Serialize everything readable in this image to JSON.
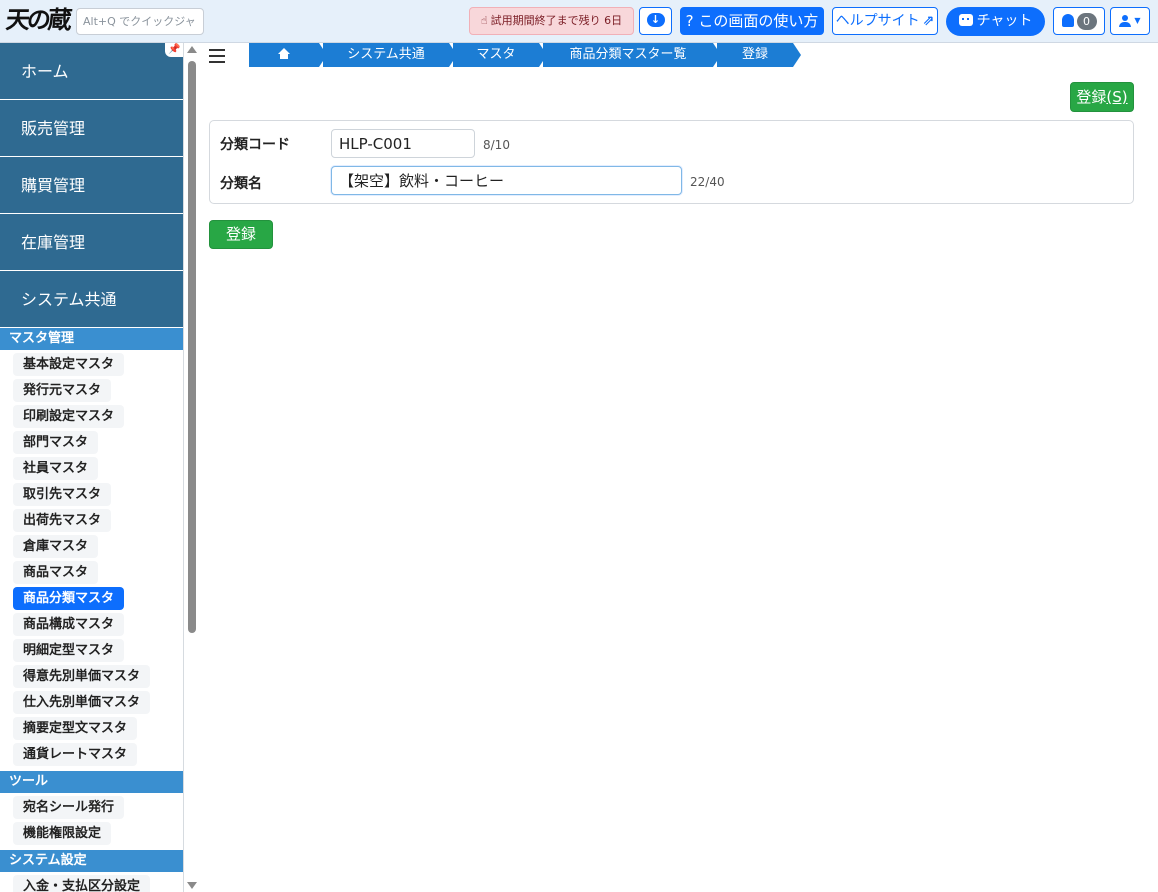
{
  "header": {
    "logo_text": "天の蔵",
    "quick_jump_placeholder": "Alt+Q でクイックジャンプ",
    "trial_text": "試用期間終了まで残り 6日",
    "howto_label": "? この画面の使い方",
    "help_label": "ヘルプサイト",
    "chat_label": "チャット",
    "notification_count": "0",
    "icons": [
      "hand-pointer-icon",
      "cloud-download-icon",
      "external-link-icon",
      "robot-icon",
      "bell-icon",
      "user-icon",
      "caret-down-icon"
    ]
  },
  "sidebar": {
    "main_items": [
      {
        "label": "ホーム"
      },
      {
        "label": "販売管理"
      },
      {
        "label": "購買管理"
      },
      {
        "label": "在庫管理"
      },
      {
        "label": "システム共通"
      }
    ],
    "sections": [
      {
        "title": "マスタ管理",
        "items": [
          {
            "label": "基本設定マスタ"
          },
          {
            "label": "発行元マスタ"
          },
          {
            "label": "印刷設定マスタ"
          },
          {
            "label": "部門マスタ"
          },
          {
            "label": "社員マスタ"
          },
          {
            "label": "取引先マスタ"
          },
          {
            "label": "出荷先マスタ"
          },
          {
            "label": "倉庫マスタ"
          },
          {
            "label": "商品マスタ"
          },
          {
            "label": "商品分類マスタ",
            "active": true
          },
          {
            "label": "商品構成マスタ"
          },
          {
            "label": "明細定型マスタ"
          },
          {
            "label": "得意先別単価マスタ"
          },
          {
            "label": "仕入先別単価マスタ"
          },
          {
            "label": "摘要定型文マスタ"
          },
          {
            "label": "通貨レートマスタ"
          }
        ]
      },
      {
        "title": "ツール",
        "items": [
          {
            "label": "宛名シール発行"
          },
          {
            "label": "機能権限設定"
          }
        ]
      },
      {
        "title": "システム設定",
        "items": [
          {
            "label": "入金・支払区分設定"
          }
        ]
      }
    ]
  },
  "breadcrumb": [
    "home-icon",
    "システム共通",
    "マスタ",
    "商品分類マスター覧",
    "登録"
  ],
  "actions": {
    "top_register_label": "登録",
    "top_register_shortcut": "(S)",
    "bottom_register_label": "登録"
  },
  "form": {
    "code_label": "分類コード",
    "code_value": "HLP-C001",
    "code_counter": "8/10",
    "name_label": "分類名",
    "name_value": "【架空】飲料・コーヒー",
    "name_counter": "22/40"
  },
  "colors": {
    "header_bg": "#e6f0fa",
    "sidebar_main": "#2f6a91",
    "section_header": "#3a8fd0",
    "active_item": "#0d6efd",
    "breadcrumb": "#1c7dd4",
    "primary": "#0d6efd",
    "success": "#28a745",
    "trial_bg": "#f8d7da"
  }
}
